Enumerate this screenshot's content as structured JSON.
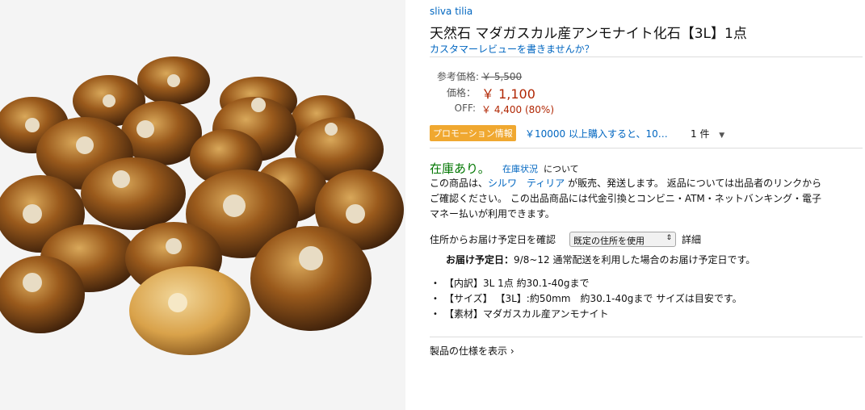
{
  "product": {
    "brand": "sliva tilia",
    "title": "天然石 マダガスカル産アンモナイト化石【3L】1点",
    "review_link": "カスタマーレビューを書きませんか？"
  },
  "pricing": {
    "list_label": "参考価格:",
    "list_price": "￥ 5,500",
    "price_label": "価格：",
    "price": "￥ 1,100",
    "off_label": "OFF:",
    "savings": "￥ 4,400 (80%)"
  },
  "promotion": {
    "badge": "プロモーション情報",
    "text": "￥10000 以上購入すると、10…",
    "count": "1 件"
  },
  "availability": {
    "status": "在庫あり。",
    "status_link": "在庫状況",
    "status_suffix": "について",
    "line1_prefix": "この商品は、",
    "seller": "シルワ　ティリア",
    "line1_suffix": " が販売、発送します。 返品については出品者のリンクから",
    "line2": "ご確認ください。 この出品商品には代金引換とコンビニ・ATM・ネットバンキング・電子",
    "line3": "マネー払いが利用できます。"
  },
  "delivery": {
    "label": "住所からお届け予定日を確認",
    "select_value": "既定の住所を使用",
    "details_link": "詳細",
    "estimate_label": "お届け予定日：",
    "estimate_text": "9/8~12 通常配送を利用した場合のお届け予定日です。"
  },
  "features": [
    "【内訳】3L 1点 約30.1-40gまで",
    "【サイズ】 【3L】:約50mm　約30.1-40gまで サイズは目安です。",
    "【素材】マダガスカル産アンモナイト"
  ],
  "spec_link": "製品の仕様を表示 ›",
  "colors": {
    "link": "#0066c0",
    "price": "#b12704",
    "in_stock": "#007600",
    "promo_badge": "#f0a830"
  }
}
